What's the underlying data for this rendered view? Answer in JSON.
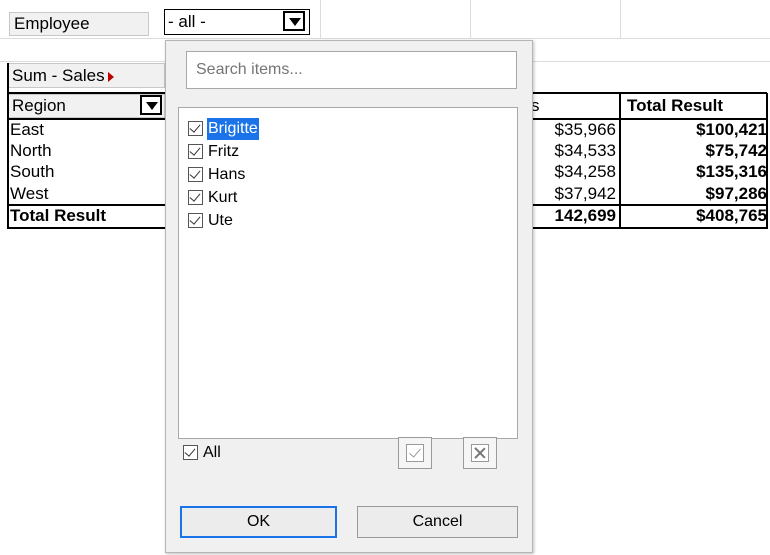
{
  "filter": {
    "label": "Employee",
    "value": "- all -"
  },
  "pivot": {
    "data_field_label": "Sum - Sales",
    "row_field_label": "Region",
    "partial_header": "s",
    "total_header": "Total Result",
    "rows": [
      {
        "region": "East",
        "partial": "$35,966",
        "total": "$100,421"
      },
      {
        "region": "North",
        "partial": "$34,533",
        "total": "$75,742"
      },
      {
        "region": "South",
        "partial": "$34,258",
        "total": "$135,316"
      },
      {
        "region": "West",
        "partial": "$37,942",
        "total": "$97,286"
      }
    ],
    "total_row": {
      "region": "Total Result",
      "partial": "142,699",
      "total": "$408,765"
    }
  },
  "popup": {
    "search_placeholder": "Search items...",
    "items": [
      {
        "label": "Brigitte",
        "checked": true,
        "selected": true
      },
      {
        "label": "Fritz",
        "checked": true,
        "selected": false
      },
      {
        "label": "Hans",
        "checked": true,
        "selected": false
      },
      {
        "label": "Kurt",
        "checked": true,
        "selected": false
      },
      {
        "label": "Ute",
        "checked": true,
        "selected": false
      }
    ],
    "all_label": "All",
    "ok_label": "OK",
    "cancel_label": "Cancel"
  },
  "colors": {
    "selection": "#1a73e8",
    "header_bg": "#f1f1f1"
  },
  "icons": {
    "dropdown": "chevron-down-icon",
    "collapse": "red-triangle-icon",
    "check_all": "check-icon",
    "uncheck_all": "close-icon"
  }
}
